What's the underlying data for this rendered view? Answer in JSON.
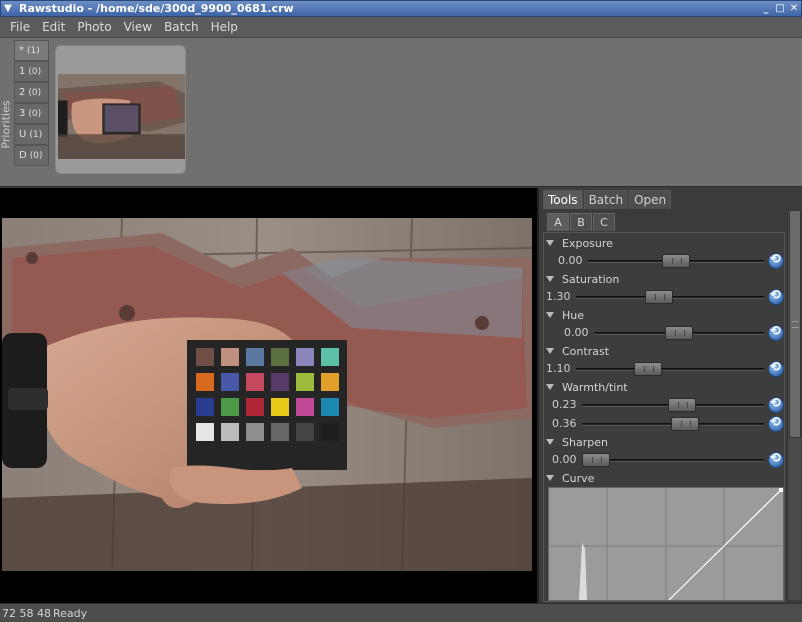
{
  "window": {
    "title": "Rawstudio - /home/sde/300d_9900_0681.crw",
    "menu_icon": "triangle-down-icon",
    "controls": {
      "minimize": "_",
      "maximize": "□",
      "close": "✕"
    }
  },
  "menu": [
    "File",
    "Edit",
    "Photo",
    "View",
    "Batch",
    "Help"
  ],
  "priorities": {
    "label": "Priorities",
    "buttons": [
      {
        "label": "*",
        "count": "(1)"
      },
      {
        "label": "1",
        "count": "(0)"
      },
      {
        "label": "2",
        "count": "(0)"
      },
      {
        "label": "3",
        "count": "(0)"
      },
      {
        "label": "U",
        "count": "(1)"
      },
      {
        "label": "D",
        "count": "(0)"
      }
    ]
  },
  "panel": {
    "tabs": [
      "Tools",
      "Batch",
      "Open"
    ],
    "active_tab": "Tools",
    "subtabs": [
      "A",
      "B",
      "C"
    ],
    "active_subtab": "A"
  },
  "tools": {
    "exposure": {
      "label": "Exposure",
      "value": "0.00",
      "level": 0.5
    },
    "saturation": {
      "label": "Saturation",
      "value": "1.30",
      "level": 0.43
    },
    "hue": {
      "label": "Hue",
      "value": "0.00",
      "level": 0.5
    },
    "contrast": {
      "label": "Contrast",
      "value": "1.10",
      "level": 0.36
    },
    "warmth": {
      "label": "Warmth/tint",
      "value1": "0.23",
      "level1": 0.56,
      "value2": "0.36",
      "level2": 0.58
    },
    "sharpen": {
      "label": "Sharpen",
      "value": "0.00",
      "level": 0.0
    },
    "curve": {
      "label": "Curve"
    }
  },
  "status": {
    "rgb": "72 58 48",
    "message": "Ready"
  },
  "colors": {
    "accent": "#3d64a6",
    "panel": "#3b3b3b",
    "preview_bg": "#000000"
  }
}
